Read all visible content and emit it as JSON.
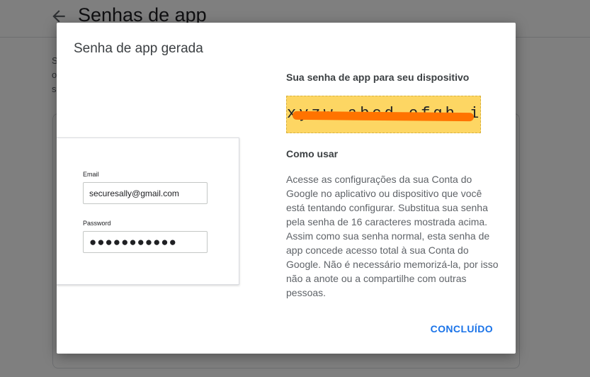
{
  "background": {
    "page_title": "Senhas de app",
    "line_1": "S",
    "line_2": "o",
    "line_3": "s"
  },
  "dialog": {
    "title": "Senha de app gerada",
    "heading": "Sua senha de app para seu dispositivo",
    "password": "xyzw abcd efgh ijkl",
    "how_to_heading": "Como usar",
    "instructions": "Acesse as configurações da sua Conta do Google no aplicativo ou dispositivo que você está tentando configurar. Substitua sua senha pela senha de 16 caracteres mostrada acima. Assim como sua senha normal, esta senha de app concede acesso total à sua Conta do Google. Não é necessário memorizá-la, por isso não a anote ou a compartilhe com outras pessoas.",
    "done_button": "CONCLUÍDO",
    "illustration": {
      "email_label": "Email",
      "email_value": "securesally@gmail.com",
      "password_label": "Password",
      "password_value": "●●●●●●●●●●●"
    }
  },
  "colors": {
    "accent": "#1a73e8",
    "password_highlight": "#fdd663",
    "redaction": "#ff7300"
  }
}
